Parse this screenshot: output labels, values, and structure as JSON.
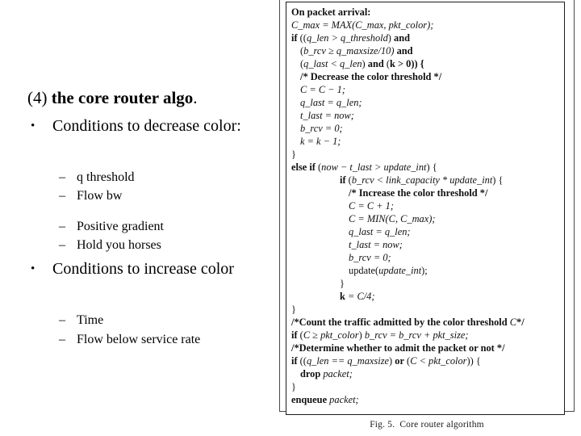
{
  "slide": {
    "title": {
      "number": "(4)",
      "emphasis": "the core router algo",
      "trailing": "."
    },
    "bullets": [
      {
        "marker": "•",
        "text": "Conditions to decrease color:",
        "children": [
          {
            "marker": "–",
            "text": "q threshold"
          },
          {
            "marker": "–",
            "text": "Flow bw"
          },
          {
            "marker": "–",
            "text": "Positive gradient"
          },
          {
            "marker": "–",
            "text": "Hold you horses"
          }
        ]
      },
      {
        "marker": "•",
        "text": "Conditions to increase color",
        "children": [
          {
            "marker": "–",
            "text": "Time"
          },
          {
            "marker": "–",
            "text": "Flow below service rate"
          }
        ]
      }
    ]
  },
  "figure": {
    "caption_number": "Fig. 5.",
    "caption_text": "Core router algorithm",
    "code_lines": [
      "On packet arrival:",
      "C_max = MAX(C_max, pkt_color);",
      "if ((q_len > q_threshold) and",
      "(b_rcv ≥ q_maxsize/10) and",
      "(q_last < q_len) and (k > 0)) {",
      "/* Decrease the color threshold */",
      "C = C − 1;",
      "q_last = q_len;",
      "t_last = now;",
      "b_rcv = 0;",
      "k = k − 1;",
      "}",
      "else if (now − t_last > update_int) {",
      "if (b_rcv < link_capacity * update_int) {",
      "/* Increase the color threshold */",
      "C = C + 1;",
      "C = MIN(C, C_max);",
      "q_last = q_len;",
      "t_last = now;",
      "b_rcv = 0;",
      "update(update_int);",
      "}",
      "k = C/4;",
      "}",
      "/*Count the traffic admitted by the color threshold C*/",
      "if (C ≥ pkt_color) b_rcv = b_rcv + pkt_size;",
      "/*Determine whether to admit the packet or not */",
      "if ((q_len == q_maxsize) or (C < pkt_color)) {",
      "drop packet;",
      "}",
      "enqueue packet;"
    ],
    "code_tokens": {
      "l0_kw": "On packet arrival:",
      "l1_a": "C_max",
      "l1_b": " = ",
      "l1_c": "MAX",
      "l1_d": "(",
      "l1_e": "C_max",
      "l1_f": ", ",
      "l1_g": "pkt_color",
      "l1_h": ");",
      "l2_kw": "if",
      "l2_rest_a": " ((",
      "l2_id1": "q_len",
      "l2_op": " > ",
      "l2_id2": "q_threshold",
      "l2_rest_b": ") ",
      "l2_and": "and",
      "l3_a": "(",
      "l3_id1": "b_rcv",
      "l3_op": " ≥ ",
      "l3_id2": "q_maxsize",
      "l3_b": "/10) ",
      "l3_and": "and",
      "l4_a": "(",
      "l4_id1": "q_last",
      "l4_op": " < ",
      "l4_id2": "q_len",
      "l4_b": ") ",
      "l4_and": "and",
      "l4_c": " (",
      "l4_id3": "k",
      "l4_op2": " > ",
      "l4_d": "0)) {",
      "l5_cm": "/* Decrease the color threshold */",
      "l6": "C = C − 1;",
      "l7_a": "q_last",
      "l7_b": " = ",
      "l7_c": "q_len",
      "l7_d": ";",
      "l8_a": "t_last",
      "l8_b": " = ",
      "l8_c": "now",
      "l8_d": ";",
      "l9_a": "b_rcv",
      "l9_b": " = 0;",
      "l10": "k = k − 1;",
      "l11": "}",
      "l12_kw": "else if",
      "l12_a": " (",
      "l12_id1": "now − t_last",
      "l12_op": " > ",
      "l12_id2": "update_int",
      "l12_b": ") {",
      "l13_kw": "if",
      "l13_a": " (",
      "l13_id1": "b_rcv",
      "l13_op": " < ",
      "l13_id2": "link_capacity",
      "l13_op2": " * ",
      "l13_id3": "update_int",
      "l13_b": ") {",
      "l14_cm": "/* Increase the color threshold */",
      "l15": "C = C + 1;",
      "l16_a": "C = ",
      "l16_b": "MIN",
      "l16_c": "(C, ",
      "l16_d": "C_max",
      "l16_e": ");",
      "l17_a": "q_last",
      "l17_b": " = ",
      "l17_c": "q_len",
      "l17_d": ";",
      "l18_a": "t_last",
      "l18_b": " = ",
      "l18_c": "now",
      "l18_d": ";",
      "l19_a": "b_rcv",
      "l19_b": " = 0;",
      "l20_a": "update(",
      "l20_b": "update_int",
      "l20_c": ");",
      "l21": "}",
      "l22": "k",
      "l22_b": " = C/4;",
      "l23": "}",
      "l24_cm_a": "/*Count the traffic admitted by the color threshold ",
      "l24_cm_b": "C",
      "l24_cm_c": "*/",
      "l25_kw": "if",
      "l25_a": " (",
      "l25_id1": "C",
      "l25_op": " ≥ ",
      "l25_id2": "pkt_color",
      "l25_b": ") ",
      "l25_id3": "b_rcv",
      "l25_c": " = ",
      "l25_id4": "b_rcv",
      "l25_d": " + ",
      "l25_id5": "pkt_size",
      "l25_e": ";",
      "l26_cm": "/*Determine whether to admit the packet or not */",
      "l27_kw": "if",
      "l27_a": " ((",
      "l27_id1": "q_len",
      "l27_op": " == ",
      "l27_id2": "q_maxsize",
      "l27_b": ") ",
      "l27_or": "or",
      "l27_c": " (",
      "l27_id3": "C",
      "l27_op2": " < ",
      "l27_id4": "pkt_color",
      "l27_d": ")) {",
      "l28_kw": "drop",
      "l28_id": " packet",
      "l28_b": ";",
      "l29": "}",
      "l30_kw": "enqueue",
      "l30_id": " packet",
      "l30_b": ";"
    }
  },
  "colors": {
    "background": "#ffffff",
    "text": "#000000",
    "frame": "#1c1c1c",
    "caption": "#1a1a1a"
  }
}
